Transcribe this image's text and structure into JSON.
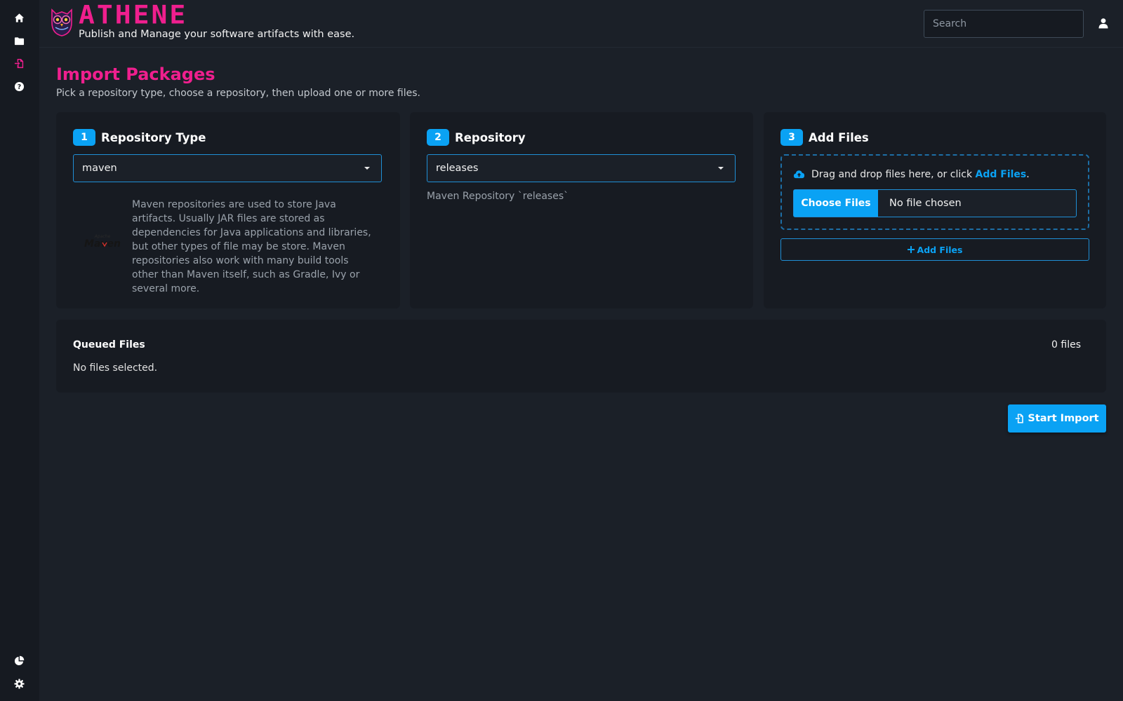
{
  "app": {
    "brand": "ATHENE",
    "tagline": "Publish and Manage your software artifacts with ease."
  },
  "colors": {
    "accent": "#ef1f8e",
    "primary": "#0aa2f4",
    "background": "#1b2028",
    "panel": "#171b22"
  },
  "sidebar": {
    "top_items": [
      {
        "icon": "home-icon",
        "active": false
      },
      {
        "icon": "folder-icon",
        "active": false
      },
      {
        "icon": "file-import-icon",
        "active": true
      },
      {
        "icon": "help-icon",
        "active": false
      }
    ],
    "bottom_items": [
      {
        "icon": "pie-chart-icon"
      },
      {
        "icon": "gear-icon"
      }
    ]
  },
  "search": {
    "placeholder": "Search",
    "value": ""
  },
  "page": {
    "title": "Import Packages",
    "subtitle": "Pick a repository type, choose a repository, then upload one or more files."
  },
  "step1": {
    "number": "1",
    "title": "Repository Type",
    "selected": "maven",
    "description": "Maven repositories are used to store Java artifacts. Usually JAR files are stored as dependencies for Java applications and libraries, but other types of file may be store. Maven repositories also work with many build tools other than Maven itself, such as Gradle, Ivy or several more.",
    "logo_small": "Apache",
    "logo_text": "Maven"
  },
  "step2": {
    "number": "2",
    "title": "Repository",
    "selected": "releases",
    "note": "Maven Repository `releases`"
  },
  "step3": {
    "number": "3",
    "title": "Add Files",
    "drop_text": "Drag and drop files here, or click ",
    "drop_link": "Add Files",
    "drop_end": ".",
    "choose_label": "Choose Files",
    "no_file": "No file chosen",
    "add_button": "Add Files"
  },
  "queue": {
    "title": "Queued Files",
    "count": "0 files",
    "empty": "No files selected."
  },
  "actions": {
    "start_import": "Start Import"
  }
}
